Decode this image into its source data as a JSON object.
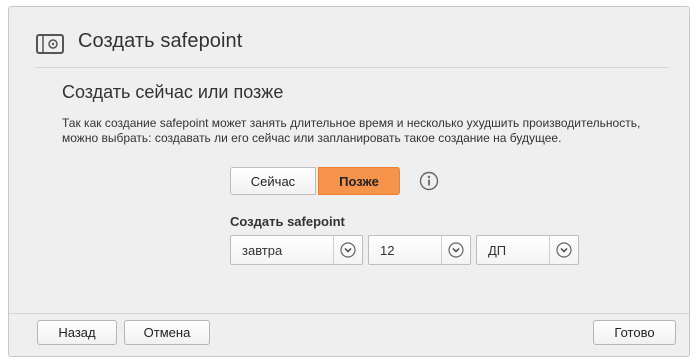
{
  "header": {
    "title": "Создать safepoint",
    "icon": "safe-icon"
  },
  "section": {
    "title": "Создать сейчас или позже",
    "description": "Так как создание safepoint может занять длительное время и несколько ухудшить производительность, можно выбрать: создавать ли его сейчас или запланировать такое создание на будущее."
  },
  "timing": {
    "now_label": "Сейчас",
    "later_label": "Позже",
    "selected": "later",
    "accent_color": "#f7944b",
    "info_icon": "info-icon"
  },
  "schedule": {
    "label": "Создать safepoint",
    "day_value": "завтра",
    "hour_value": "12",
    "ampm_value": "ДП"
  },
  "footer": {
    "back_label": "Назад",
    "cancel_label": "Отмена",
    "done_label": "Готово"
  }
}
